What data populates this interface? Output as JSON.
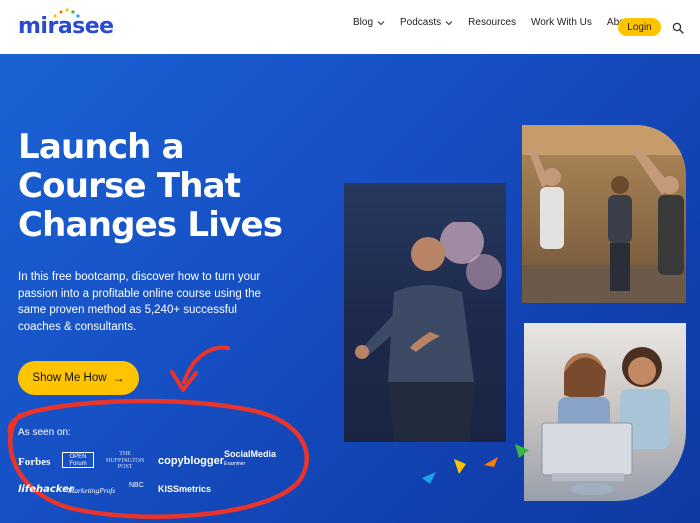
{
  "brand": {
    "name": "mirasee"
  },
  "nav": {
    "items": [
      {
        "label": "Blog",
        "dropdown": true
      },
      {
        "label": "Podcasts",
        "dropdown": true
      },
      {
        "label": "Resources",
        "dropdown": false
      },
      {
        "label": "Work With Us",
        "dropdown": false
      },
      {
        "label": "About",
        "dropdown": false
      }
    ],
    "login_label": "Login",
    "search_icon": "search-icon"
  },
  "hero": {
    "headline_lines": [
      "Launch a",
      "Course That",
      "Changes Lives"
    ],
    "subtext_lines": [
      "In this free bootcamp, discover how to turn your",
      "passion into a profitable online course using the",
      "same proven method as 5,240+ successful",
      "coaches & consultants."
    ],
    "cta_label": "Show Me How",
    "cta_arrow": "→"
  },
  "press": {
    "heading": "As seen on:",
    "row1": {
      "forbes": "Forbes",
      "open_forum_top": "OPEN",
      "open_forum_bottom": "Forum",
      "huff_1": "THE",
      "huff_2": "HUFFINGTON",
      "huff_3": "POST",
      "copyblogger": "copyblogger",
      "sme_main": "SocialMedia",
      "sme_sub": "Examiner"
    },
    "row2": {
      "lifehacker": "lifehacker",
      "marketingprofs": "MarketingProfs",
      "nbc": "NBC",
      "kissmetrics": "KISSmetrics"
    }
  },
  "colors": {
    "accent_yellow": "#ffc400",
    "hero_blue": "#1552c8",
    "annotation_red": "#e8342a",
    "logo_blue": "#2a4bd0"
  }
}
